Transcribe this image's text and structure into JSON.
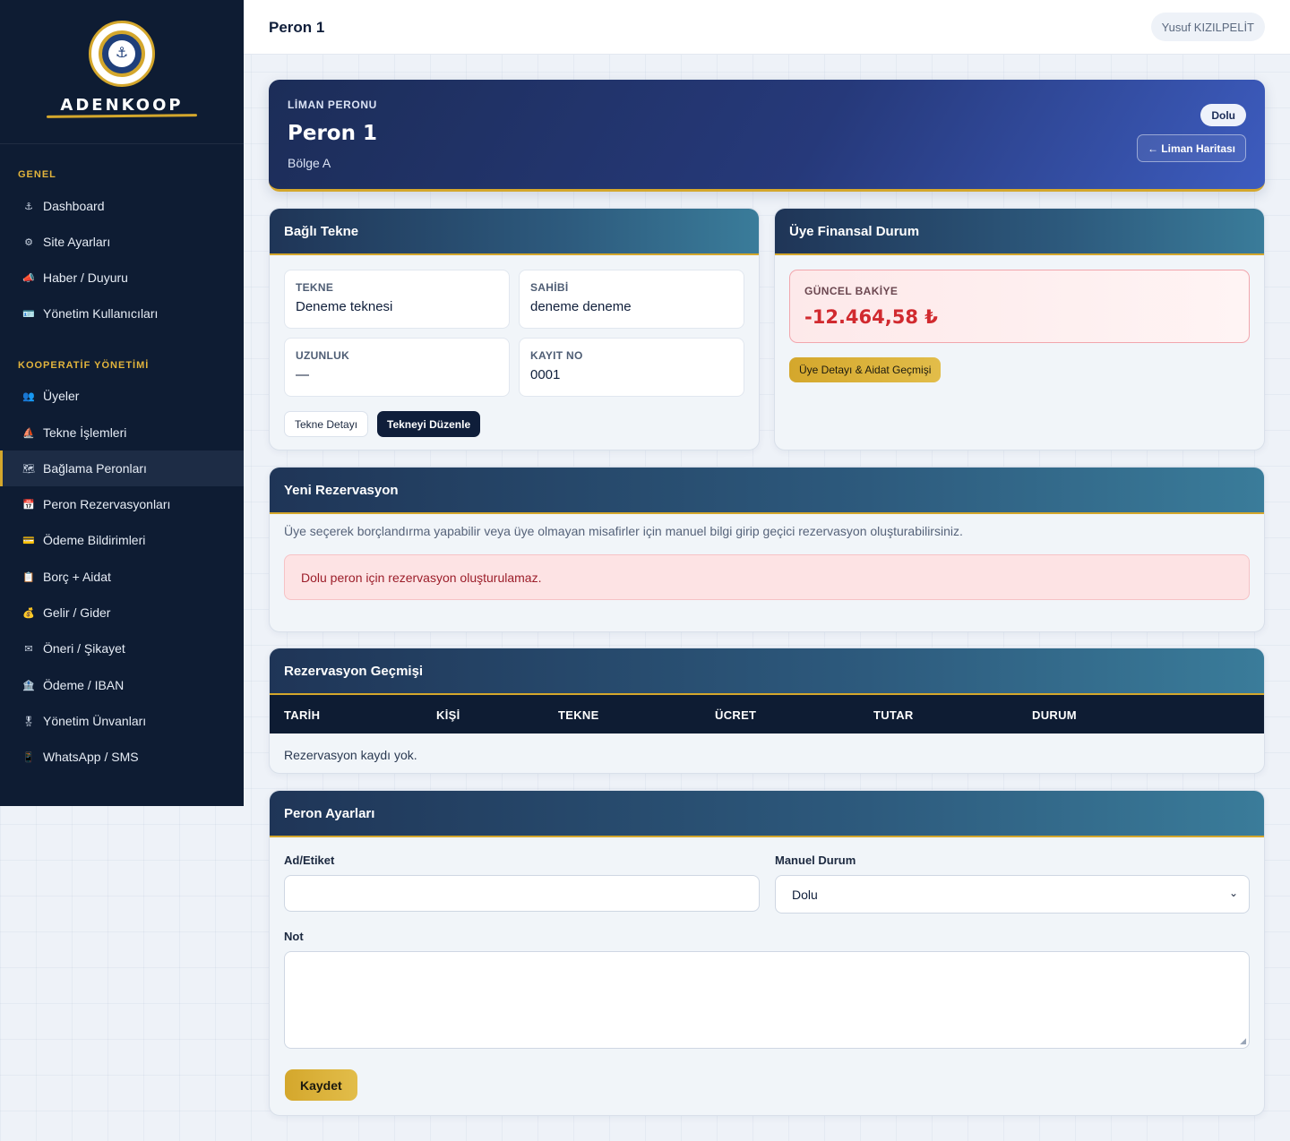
{
  "sidebar": {
    "brand": "ADENKOOP",
    "sections": [
      {
        "title": "GENEL",
        "items": [
          {
            "label": "Dashboard",
            "icon": "anchor-icon",
            "glyph": "⚓"
          },
          {
            "label": "Site Ayarları",
            "icon": "gear-icon",
            "glyph": "⚙"
          },
          {
            "label": "Haber / Duyuru",
            "icon": "megaphone-icon",
            "glyph": "📣"
          },
          {
            "label": "Yönetim Kullanıcıları",
            "icon": "id-card-icon",
            "glyph": "🪪"
          }
        ]
      },
      {
        "title": "KOOPERATİF YÖNETİMİ",
        "items": [
          {
            "label": "Üyeler",
            "icon": "users-icon",
            "glyph": "👥"
          },
          {
            "label": "Tekne İşlemleri",
            "icon": "sailboat-icon",
            "glyph": "⛵"
          },
          {
            "label": "Bağlama Peronları",
            "icon": "map-icon",
            "glyph": "🗺",
            "active": true
          },
          {
            "label": "Peron Rezervasyonları",
            "icon": "calendar-icon",
            "glyph": "📅"
          },
          {
            "label": "Ödeme Bildirimleri",
            "icon": "credit-card-icon",
            "glyph": "💳"
          },
          {
            "label": "Borç + Aidat",
            "icon": "clipboard-icon",
            "glyph": "📋"
          },
          {
            "label": "Gelir / Gider",
            "icon": "money-bag-icon",
            "glyph": "💰"
          },
          {
            "label": "Öneri / Şikayet",
            "icon": "envelope-icon",
            "glyph": "✉"
          },
          {
            "label": "Ödeme / IBAN",
            "icon": "bank-icon",
            "glyph": "🏦"
          },
          {
            "label": "Yönetim Ünvanları",
            "icon": "medal-icon",
            "glyph": "🎖"
          },
          {
            "label": "WhatsApp / SMS",
            "icon": "phone-icon",
            "glyph": "📱"
          }
        ]
      }
    ]
  },
  "topbar": {
    "title": "Peron 1",
    "user": "Yusuf KIZILPELİT"
  },
  "hero": {
    "eyebrow": "LİMAN PERONU",
    "title": "Peron 1",
    "subtitle": "Bölge A",
    "status_badge": "Dolu",
    "back_button": "← Liman Haritası"
  },
  "boat_card": {
    "title": "Bağlı Tekne",
    "fields": [
      {
        "label": "TEKNE",
        "value": "Deneme teknesi"
      },
      {
        "label": "SAHİBİ",
        "value": "deneme deneme"
      },
      {
        "label": "UZUNLUK",
        "value": "—"
      },
      {
        "label": "KAYIT NO",
        "value": "0001"
      }
    ],
    "detail_button": "Tekne Detayı",
    "edit_button": "Tekneyi Düzenle"
  },
  "finance_card": {
    "title": "Üye Finansal Durum",
    "balance_label": "GÜNCEL BAKİYE",
    "balance_value": "-12.464,58 ₺",
    "history_button": "Üye Detayı & Aidat Geçmişi"
  },
  "reservation_card": {
    "title": "Yeni Rezervasyon",
    "description": "Üye seçerek borçlandırma yapabilir veya üye olmayan misafirler için manuel bilgi girip geçici rezervasyon oluşturabilirsiniz.",
    "alert": "Dolu peron için rezervasyon oluşturulamaz."
  },
  "history_card": {
    "title": "Rezervasyon Geçmişi",
    "columns": [
      "TARİH",
      "KİŞİ",
      "TEKNE",
      "ÜCRET",
      "TUTAR",
      "DURUM"
    ],
    "empty_text": "Rezervasyon kaydı yok."
  },
  "settings_card": {
    "title": "Peron Ayarları",
    "name_label": "Ad/Etiket",
    "name_value": "",
    "status_label": "Manuel Durum",
    "status_value": "Dolu",
    "note_label": "Not",
    "note_value": "",
    "save_button": "Kaydet"
  },
  "colors": {
    "accent_gold": "#d4a72c",
    "navy": "#0e1c33",
    "danger": "#d12a2f"
  }
}
